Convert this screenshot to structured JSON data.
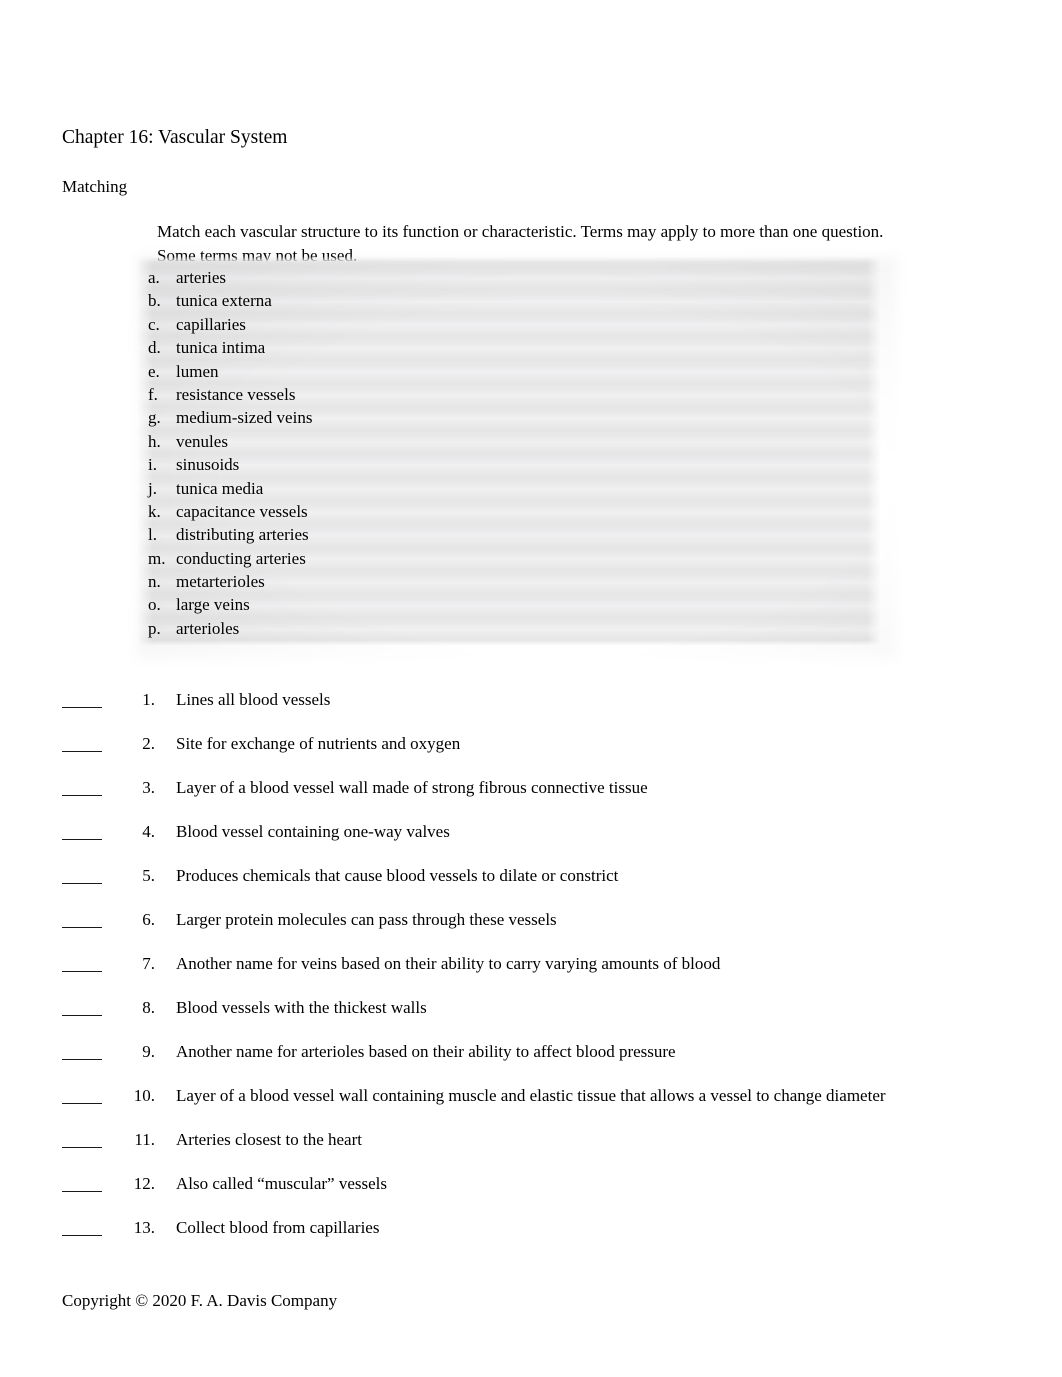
{
  "document": {
    "title": "Chapter 16: Vascular System",
    "section_heading": "Matching",
    "instructions_line1": "Match each vascular structure to its function or characteristic. Terms may apply to more than one question.",
    "instructions_line2": "Some terms may not be used.",
    "footer": "Copyright © 2020 F. A. Davis Company"
  },
  "options": [
    {
      "letter": "a.",
      "text": "arteries"
    },
    {
      "letter": "b.",
      "text": "tunica externa"
    },
    {
      "letter": "c.",
      "text": "capillaries"
    },
    {
      "letter": "d.",
      "text": "tunica intima"
    },
    {
      "letter": "e.",
      "text": "lumen"
    },
    {
      "letter": "f.",
      "text": "resistance vessels"
    },
    {
      "letter": "g.",
      "text": "medium-sized veins"
    },
    {
      "letter": "h.",
      "text": "venules"
    },
    {
      "letter": "i.",
      "text": "sinusoids"
    },
    {
      "letter": "j.",
      "text": "tunica media"
    },
    {
      "letter": "k.",
      "text": "capacitance vessels"
    },
    {
      "letter": "l.",
      "text": "distributing arteries"
    },
    {
      "letter": "m.",
      "text": "conducting arteries"
    },
    {
      "letter": "n.",
      "text": "metarterioles"
    },
    {
      "letter": "o.",
      "text": "large veins"
    },
    {
      "letter": "p.",
      "text": "arterioles"
    }
  ],
  "questions": [
    {
      "number": "1.",
      "text": "Lines all blood vessels",
      "answer": ""
    },
    {
      "number": "2.",
      "text": "Site for exchange of nutrients and oxygen",
      "answer": ""
    },
    {
      "number": "3.",
      "text": "Layer of a blood vessel wall made of strong fibrous connective tissue",
      "answer": ""
    },
    {
      "number": "4.",
      "text": "Blood vessel containing one-way valves",
      "answer": ""
    },
    {
      "number": "5.",
      "text": "Produces chemicals that cause blood vessels to dilate or constrict",
      "answer": ""
    },
    {
      "number": "6.",
      "text": "Larger protein molecules can pass through these vessels",
      "answer": ""
    },
    {
      "number": "7.",
      "text": "Another name for veins based on their ability to carry varying amounts of blood",
      "answer": ""
    },
    {
      "number": "8.",
      "text": "Blood vessels with the thickest walls",
      "answer": ""
    },
    {
      "number": "9.",
      "text": "Another name for arterioles based on their ability to affect blood pressure",
      "answer": ""
    },
    {
      "number": "10.",
      "text": "Layer of a blood vessel wall containing muscle and elastic tissue that allows a vessel to change diameter",
      "answer": ""
    },
    {
      "number": "11.",
      "text": "Arteries closest to the heart",
      "answer": ""
    },
    {
      "number": "12.",
      "text": "Also called “muscular” vessels",
      "answer": ""
    },
    {
      "number": "13.",
      "text": "Collect blood from capillaries",
      "answer": ""
    }
  ],
  "colors": {
    "page_background": "#ffffff",
    "text": "#000000",
    "panel_light": "#f2f2f3",
    "panel_dark": "#e6e6e7"
  }
}
